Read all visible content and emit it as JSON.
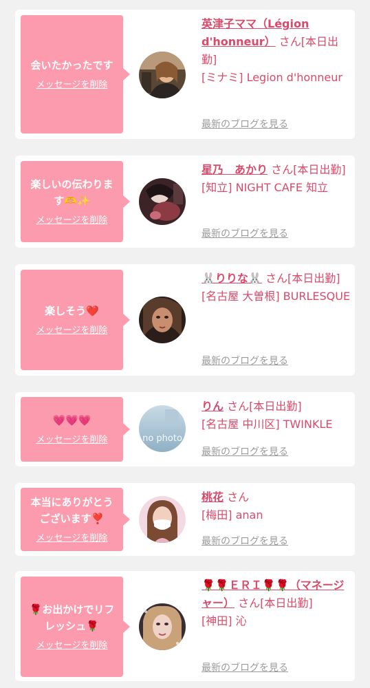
{
  "colors": {
    "page_bg": "#f1f1f1",
    "card_bg": "#ffffff",
    "bubble": "#fc9aae",
    "accent_text": "#d94a6a",
    "muted_link": "#9b9b9b"
  },
  "common": {
    "delete_label": "メッセージを削除",
    "blog_label": "最新のブログを見る"
  },
  "items": [
    {
      "message": "会いたかったです",
      "name": "英津子ママ（Légion d'honneur）",
      "suffix": "さん[本日出勤]",
      "shop": "[ミナミ] Legion d'honneur",
      "avatar_icon": "woman-photo"
    },
    {
      "message": "楽しいの伝わります🫶✨",
      "name": "星乃　あかり",
      "suffix": "さん[本日出勤]",
      "shop": "[知立] NIGHT CAFE 知立",
      "avatar_icon": "woman-photo"
    },
    {
      "message": "楽しそう❤️",
      "name": "🐰りりな🐰",
      "suffix": "さん[本日出勤]",
      "shop": "[名古屋 大曽根] BURLESQUE",
      "avatar_icon": "woman-photo"
    },
    {
      "message": "💗💗💗",
      "name": "りん",
      "suffix": "さん[本日出勤]",
      "shop": "[名古屋 中川区] TWINKLE",
      "avatar_icon": "no-photo",
      "avatar_text": "no photo"
    },
    {
      "message": "本当にありがとうございます❣️",
      "name": "桃花",
      "suffix": "さん",
      "shop": "[梅田] anan",
      "avatar_icon": "woman-photo"
    },
    {
      "message": "🌹お出かけでリフレッシュ🌹",
      "name": "🌹🌹ＥＲＩ🌹🌹（マネージャー）",
      "suffix": "さん[本日出勤]",
      "shop": "[神田] 沁",
      "avatar_icon": "woman-photo"
    }
  ]
}
